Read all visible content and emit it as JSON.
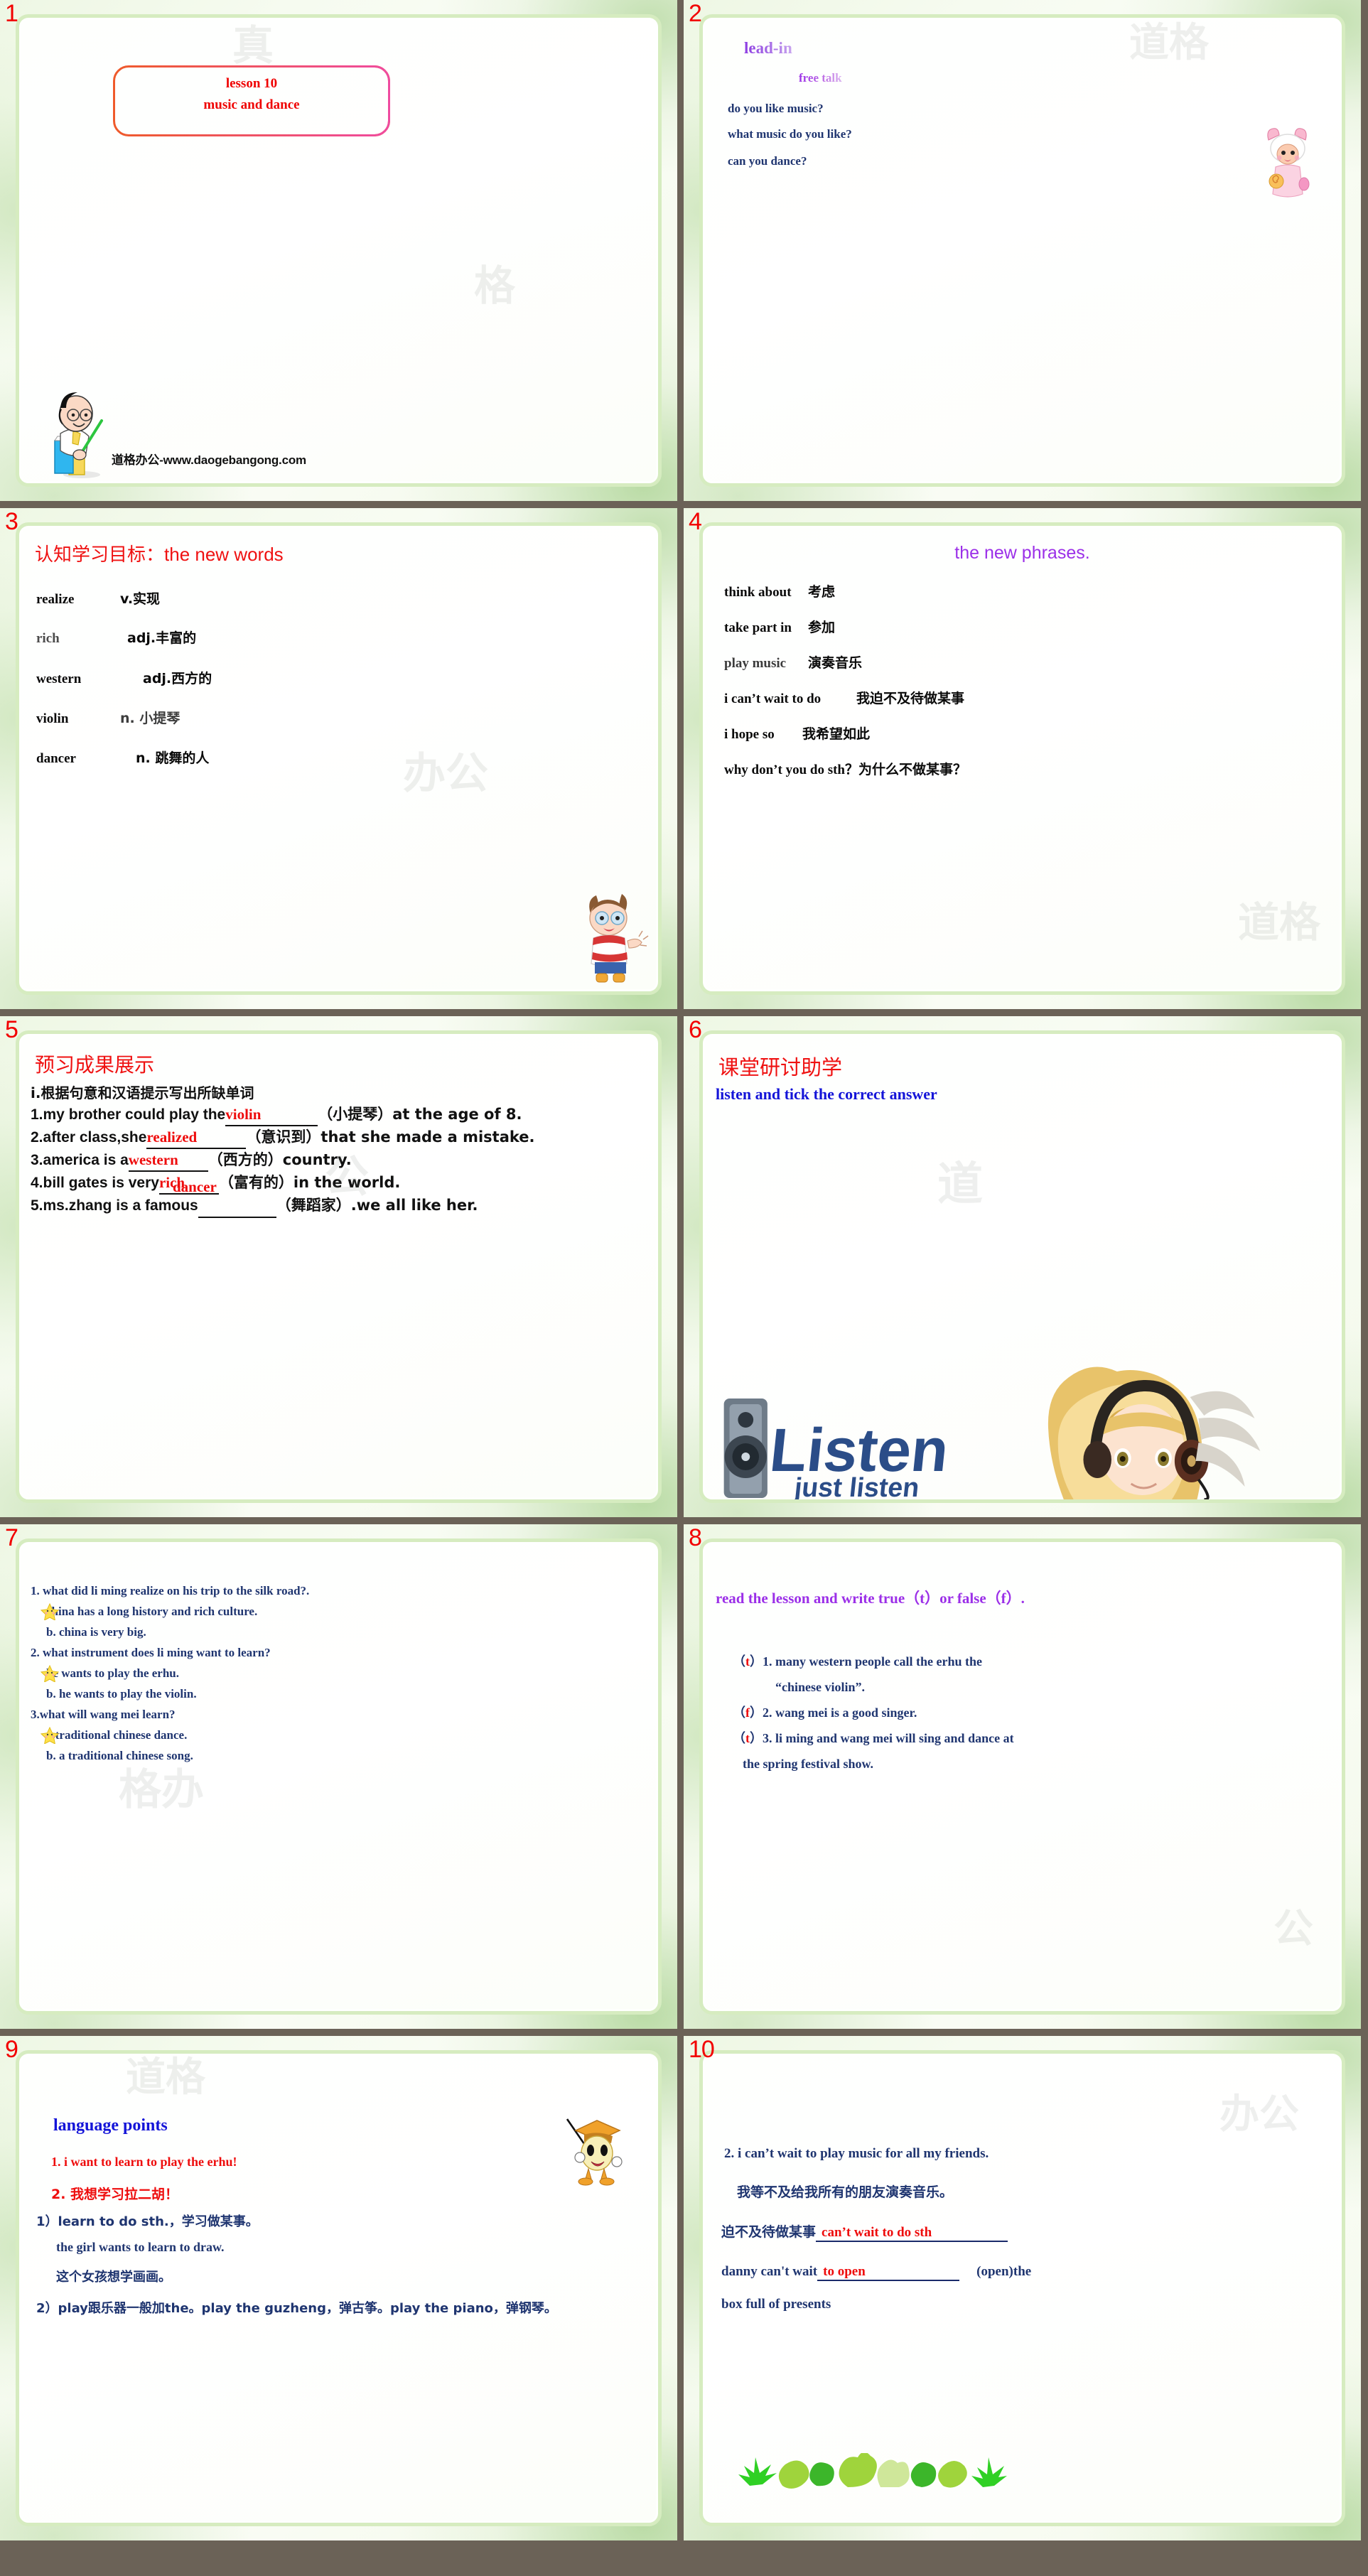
{
  "deck": {
    "watermark": "道格办公-www.daogebangong.com",
    "accent_red": "#ef0000",
    "accent_purple": "#9b2fe8",
    "accent_blue": "#1f3570",
    "page_numbers": [
      "1",
      "2",
      "3",
      "4",
      "5",
      "6",
      "7",
      "8",
      "9",
      "10"
    ]
  },
  "slide1": {
    "number": "1",
    "title_line1": "lesson  10",
    "title_line2": "music and dance",
    "url": "道格办公-www.daogebangong.com"
  },
  "slide2": {
    "number": "2",
    "lead_in": "lead-in",
    "free_talk": "free talk",
    "questions": [
      "do you like music?",
      "what music do you like?",
      "can you dance?"
    ]
  },
  "slide3": {
    "number": "3",
    "heading_cn": "认知学习目标：",
    "heading_en": "the new words",
    "words": [
      {
        "word": "realize",
        "pos_def": "v.实现"
      },
      {
        "word": "rich",
        "pos_def": "adj.丰富的"
      },
      {
        "word": "western",
        "pos_def": "adj.西方的"
      },
      {
        "word": "violin",
        "pos_def": "n. 小提琴"
      },
      {
        "word": "dancer",
        "pos_def": "n. 跳舞的人"
      }
    ]
  },
  "slide4": {
    "number": "4",
    "heading": "the new phrases.",
    "phrases": [
      {
        "en": "think about",
        "cn": "考虑"
      },
      {
        "en": "take part in",
        "cn": "参加"
      },
      {
        "en": "play music",
        "cn": "演奏音乐"
      },
      {
        "en": "i can’t wait to do",
        "cn": "我迫不及待做某事"
      },
      {
        "en": "i hope so",
        "cn": "我希望如此"
      },
      {
        "en": "why don’t you do sth？",
        "cn": "为什么不做某事？"
      }
    ]
  },
  "slide5": {
    "number": "5",
    "heading": "预习成果展示",
    "instruction": "i.根据句意和汉语提示写出所缺单词",
    "items": [
      {
        "pre": "1.my brother could play the",
        "answer": "violin",
        "post": "（小提琴）at the age of 8."
      },
      {
        "pre": "2.after class,she",
        "answer": "realized",
        "post": "（意识到）that she made a mistake."
      },
      {
        "pre": "3.america is a",
        "answer": "western",
        "post": "（西方的）country."
      },
      {
        "pre": "4.bill gates is very",
        "answer": "rich",
        "post": "（富有的）in the world."
      },
      {
        "pre": "5.ms.zhang is a famous",
        "answer": "dancer",
        "post": "（舞蹈家）.we all like her."
      }
    ]
  },
  "slide6": {
    "number": "6",
    "heading": "课堂研讨助学",
    "subheading": "listen and tick the correct answer",
    "image_text": "Listen just listen"
  },
  "slide7": {
    "number": "7",
    "questions": [
      {
        "q": "1. what did li ming realize on his trip to the silk road?.",
        "a_starred": "china has a long history and  rich culture.",
        "b": "b. china is very big."
      },
      {
        "q": "2. what instrument does li ming want to learn?",
        "a_starred": "he wants to play the erhu.",
        "b": "b. he wants to play the violin."
      },
      {
        "q": "3.what will wang mei learn?",
        "a_starred": "a traditional chinese dance.",
        "b": "b. a traditional chinese song."
      }
    ]
  },
  "slide8": {
    "number": "8",
    "heading": "read the lesson and write true（t）or false（f）.",
    "items": [
      {
        "mark": "t",
        "text": "1. many western people call the erhu the",
        "text2": "“chinese violin”."
      },
      {
        "mark": "f",
        "text": "2. wang mei is a good singer.",
        "text2": ""
      },
      {
        "mark": "t",
        "text": "3. li ming and wang mei will sing and dance at",
        "text2": "the spring festival show."
      }
    ]
  },
  "slide9": {
    "number": "9",
    "title": "language points",
    "line1": "1. i want to learn to play the erhu!",
    "line2": "2.   我想学习拉二胡！",
    "line3": "1）learn to do sth.，学习做某事。",
    "line4": "the girl wants to learn to draw.",
    "line5": "这个女孩想学画画。",
    "line6": "2）play跟乐器一般加the。play the guzheng，弹古筝。play the piano，弹钢琴。"
  },
  "slide10": {
    "number": "10",
    "line1": "2. i can’t wait to play music for all my friends.",
    "line2": "我等不及给我所有的朋友演奏音乐。",
    "line3_label": "迫不及待做某事",
    "line3_answer": "can’t wait to do sth",
    "line4_pre": "danny can't wait",
    "line4_answer": "to open",
    "line4_post": "(open)the",
    "line5": "box full of presents"
  }
}
